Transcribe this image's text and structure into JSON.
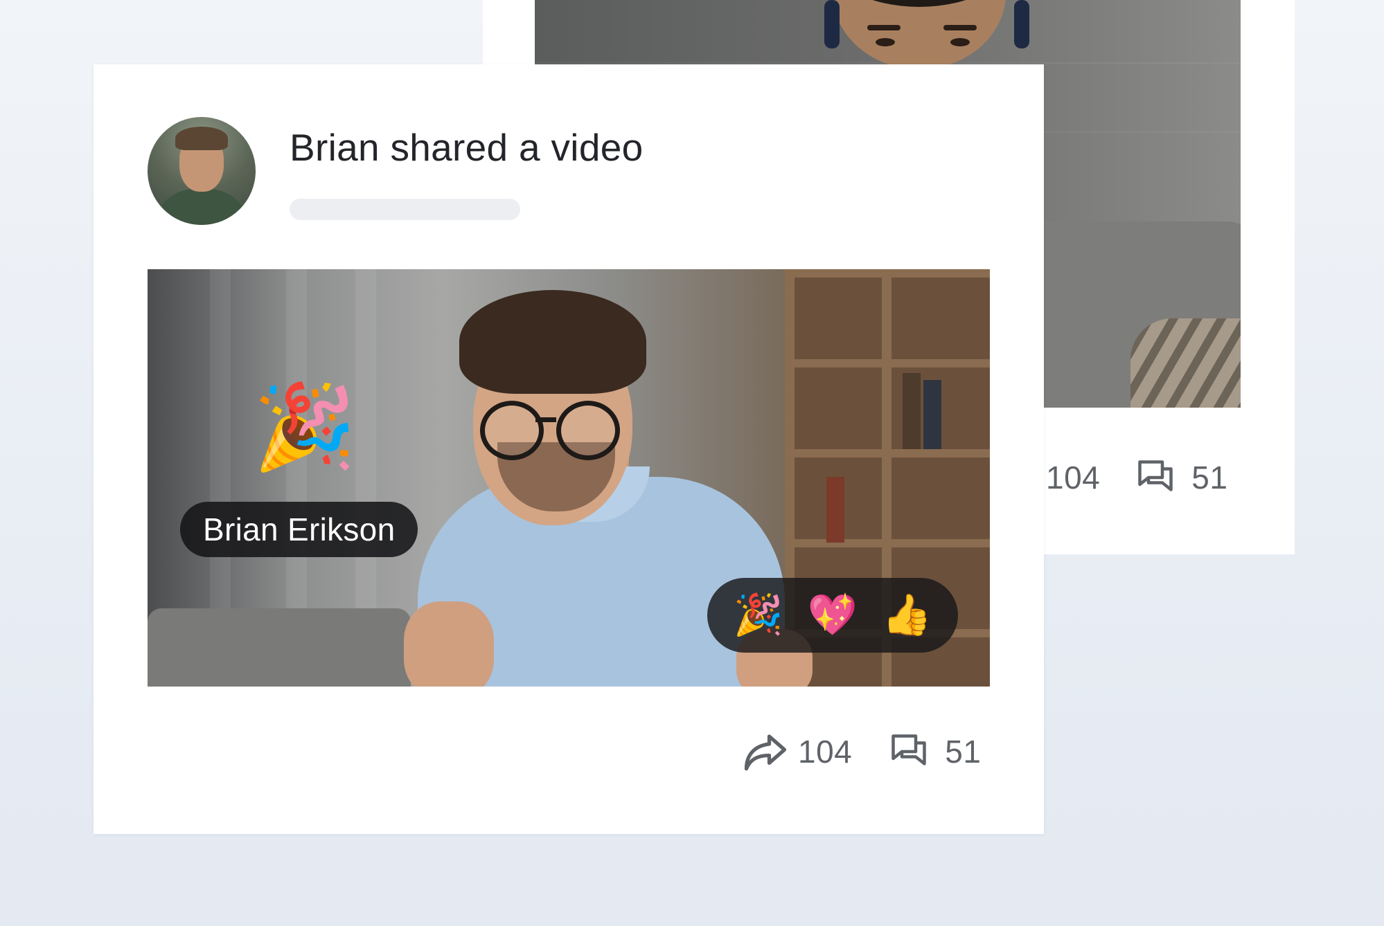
{
  "back_card": {
    "stats": {
      "shares": "104",
      "comments": "51"
    }
  },
  "post": {
    "title": "Brian shared a video",
    "video": {
      "name_tag": "Brian Erikson",
      "overlay_emoji": "🎉",
      "reactions": [
        "🎉",
        "💖",
        "👍"
      ]
    },
    "stats": {
      "shares": "104",
      "comments": "51"
    }
  },
  "icons": {
    "share": "share-arrow-icon",
    "comment": "comment-bubbles-icon"
  },
  "colors": {
    "background": "#eaeef4",
    "card": "#ffffff",
    "text_primary": "#23252a",
    "text_secondary": "#5f6368"
  }
}
